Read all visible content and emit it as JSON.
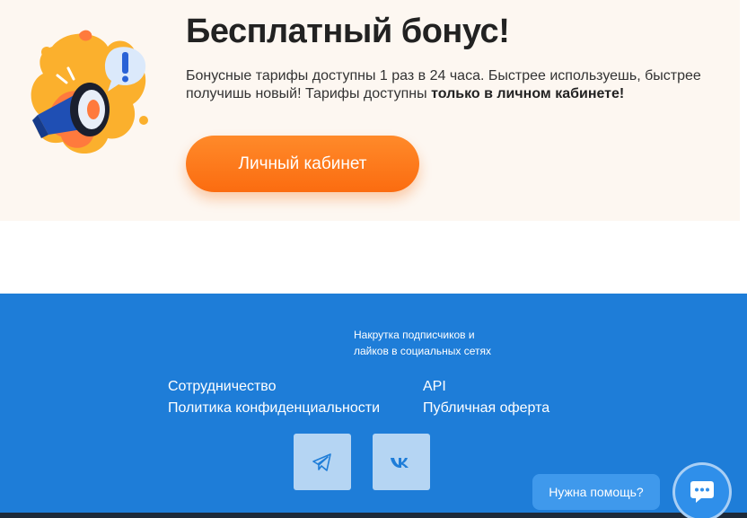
{
  "bonus": {
    "illustration_icon": "megaphone-icon",
    "title": "Бесплатный бонус!",
    "text_plain": "Бонусные тарифы доступны 1 раз в 24 часа. Быстрее используешь, быстрее получишь новый! Тарифы доступны ",
    "text_bold": "только в личном кабинете!",
    "button_label": "Личный кабинет",
    "accent_color": "#fb6c10",
    "background_color": "#fdf7f1"
  },
  "footer": {
    "background_color": "#1e7dd8",
    "tagline_line1": "Накрутка подписчиков и",
    "tagline_line2": "лайков в социальных сетях",
    "links": [
      {
        "label": "Сотрудничество"
      },
      {
        "label": "Политика конфиденциальности"
      },
      {
        "label": "API"
      },
      {
        "label": "Публичная оферта"
      }
    ],
    "socials": [
      {
        "icon": "telegram-icon"
      },
      {
        "icon": "vk-icon"
      }
    ]
  },
  "help": {
    "label": "Нужна помощь?",
    "icon": "chat-icon"
  }
}
